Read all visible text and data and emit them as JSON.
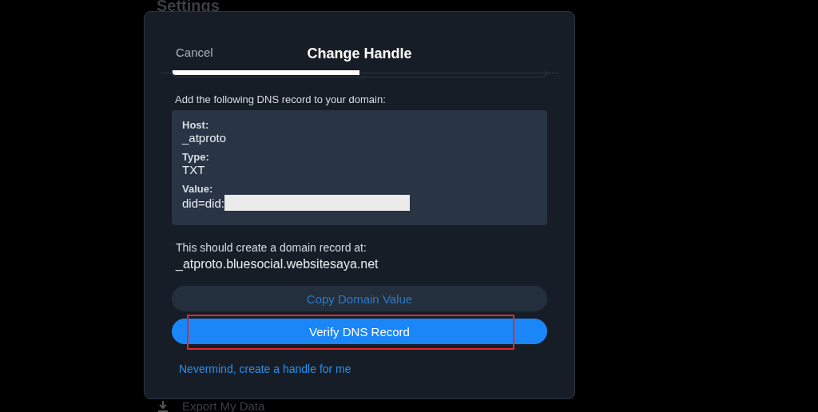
{
  "background": {
    "heading": "Settings",
    "export_row": {
      "label": "Export My Data"
    }
  },
  "dialog": {
    "cancel": "Cancel",
    "title": "Change Handle",
    "instruction": "Add the following DNS record to your domain:",
    "record": [
      {
        "label": "Host:",
        "value": "_atproto",
        "redacted": false
      },
      {
        "label": "Type:",
        "value": "TXT",
        "redacted": false
      },
      {
        "label": "Value:",
        "value": "did=did:",
        "redacted": true
      }
    ],
    "note": "This should create a domain record at:",
    "domain": "_atproto.bluesocial.websitesaya.net",
    "copy_button": "Copy Domain Value",
    "verify_button": {
      "label": "Verify DNS Record",
      "highlighted": true
    },
    "fallback_link": "Nevermind, create a handle for me"
  }
}
